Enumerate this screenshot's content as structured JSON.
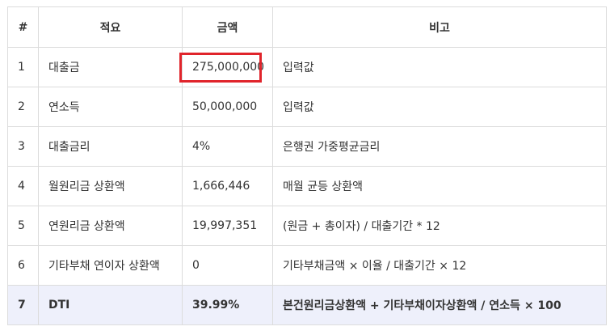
{
  "header": {
    "col_no": "#",
    "col_item": "적요",
    "col_amount": "금액",
    "col_note": "비고"
  },
  "rows": [
    {
      "no": "1",
      "item": "대출금",
      "amount": "275,000,000",
      "note": "입력값"
    },
    {
      "no": "2",
      "item": "연소득",
      "amount": "50,000,000",
      "note": "입력값"
    },
    {
      "no": "3",
      "item": "대출금리",
      "amount": "4%",
      "note": "은행권 가중평균금리"
    },
    {
      "no": "4",
      "item": "월원리금 상환액",
      "amount": "1,666,446",
      "note": "매월 균등 상환액"
    },
    {
      "no": "5",
      "item": "연원리금 상환액",
      "amount": "19,997,351",
      "note": "(원금 + 총이자) / 대출기간 * 12"
    },
    {
      "no": "6",
      "item": "기타부채 연이자 상환액",
      "amount": "0",
      "note": "기타부채금액 × 이율 / 대출기간 × 12"
    },
    {
      "no": "7",
      "item": "DTI",
      "amount": "39.99%",
      "note": "본건원리금상환액 + 기타부채이자상환액 / 연소득 × 100"
    }
  ],
  "colors": {
    "highlight_border": "#e0242b",
    "total_row_bg": "#eef0fb",
    "grid": "#dcdcdc"
  }
}
